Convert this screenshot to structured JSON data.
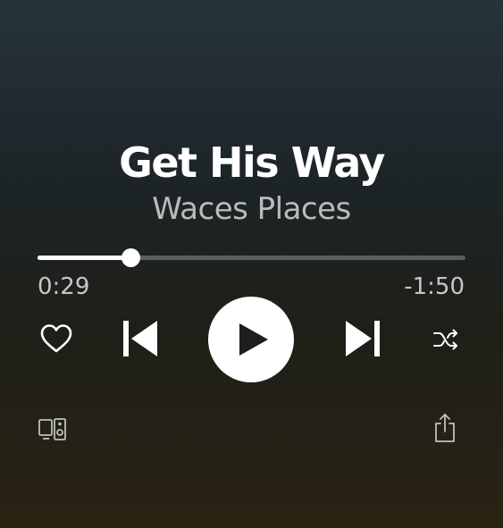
{
  "now_playing": {
    "title": "Get His Way",
    "artist": "Waces Places"
  },
  "progress": {
    "elapsed": "0:29",
    "remaining": "-1:50",
    "fraction": 0.218
  },
  "controls": {
    "like": "heart-icon",
    "previous": "skip-previous-icon",
    "play": "play-icon",
    "next": "skip-next-icon",
    "shuffle": "shuffle-icon",
    "devices": "devices-icon",
    "share": "share-icon"
  },
  "colors": {
    "accent": "#ffffff",
    "secondary_text": "#b9bcbd",
    "track_bg": "#5b5e5c",
    "play_icon": "#1c1f1d"
  }
}
